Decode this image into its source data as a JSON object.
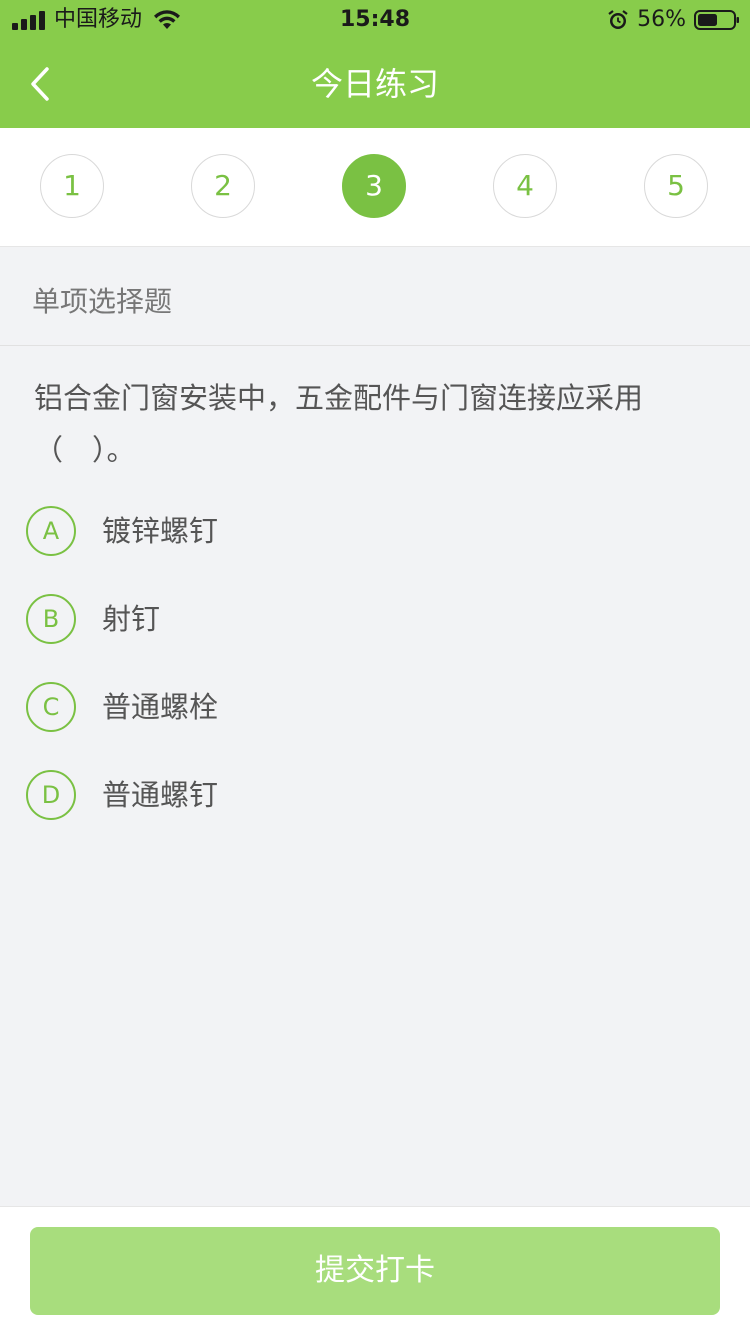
{
  "statusbar": {
    "carrier": "中国移动",
    "time": "15:48",
    "battery_percent": "56%",
    "battery_level": 0.56,
    "icons": [
      "signal-icon",
      "wifi-icon",
      "alarm-icon",
      "battery-icon"
    ]
  },
  "nav": {
    "title": "今日练习",
    "back_icon": "chevron-left-icon"
  },
  "stepper": {
    "steps": [
      "1",
      "2",
      "3",
      "4",
      "5"
    ],
    "active_index": 2
  },
  "section": {
    "label": "单项选择题"
  },
  "question": {
    "text": "铝合金门窗安装中，五金配件与门窗连接应采用（　）。"
  },
  "options": [
    {
      "letter": "A",
      "text": "镀锌螺钉"
    },
    {
      "letter": "B",
      "text": "射钉"
    },
    {
      "letter": "C",
      "text": "普通螺栓"
    },
    {
      "letter": "D",
      "text": "普通螺钉"
    }
  ],
  "footer": {
    "submit_label": "提交打卡"
  },
  "colors": {
    "primary": "#7ac143",
    "header": "#88cc4b",
    "submit_disabled": "#a8dd7d",
    "background": "#f2f3f5"
  }
}
